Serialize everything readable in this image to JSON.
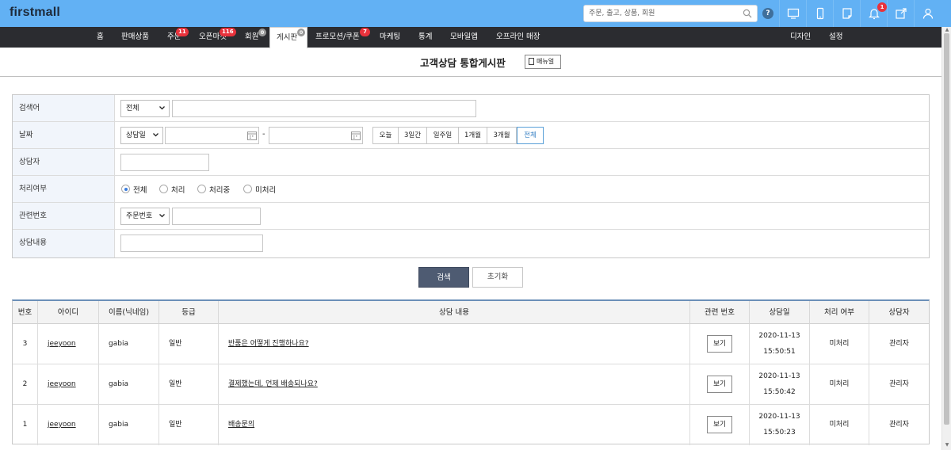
{
  "header": {
    "logo": "firstmall",
    "search_placeholder": "주문, 출고, 상품, 회원",
    "help": "?",
    "bell_badge": "1"
  },
  "menu": {
    "items": [
      {
        "label": "홈"
      },
      {
        "label": "판매상품"
      },
      {
        "label": "주문",
        "badge": "11"
      },
      {
        "label": "오픈마켓",
        "badge": "116"
      },
      {
        "label": "회원",
        "badge": "0"
      },
      {
        "label": "게시판",
        "badge": "0"
      },
      {
        "label": "프로모션/쿠폰",
        "badge": "7"
      },
      {
        "label": "마케팅"
      },
      {
        "label": "통계"
      },
      {
        "label": "모바일앱"
      },
      {
        "label": "오프라인 매장"
      }
    ],
    "right": [
      {
        "label": "디자인"
      },
      {
        "label": "설정"
      }
    ]
  },
  "page": {
    "title": "고객상담 통합게시판",
    "manual_label": "매뉴얼"
  },
  "filter": {
    "keyword_label": "검색어",
    "keyword_select": "전체",
    "date_label": "날짜",
    "date_select": "상담일",
    "date_sep": "-",
    "quick": [
      "오늘",
      "3일간",
      "일주일",
      "1개월",
      "3개월",
      "전체"
    ],
    "counselor_label": "상담자",
    "status_label": "처리여부",
    "status_options": [
      "전체",
      "처리",
      "처리중",
      "미처리"
    ],
    "related_label": "관련번호",
    "related_select": "주문번호",
    "content_label": "상담내용",
    "search_button": "검색",
    "reset_button": "초기화"
  },
  "table": {
    "headers": [
      "번호",
      "아이디",
      "이름(닉네임)",
      "등급",
      "상담 내용",
      "관련 번호",
      "상담일",
      "처리 여부",
      "상담자"
    ],
    "view_label": "보기",
    "rows": [
      {
        "no": "3",
        "id": "jeeyoon",
        "name": "gabia",
        "grade": "일반",
        "content": "반품은 어떻게 진행하나요?",
        "date": "2020-11-13",
        "time": "15:50:51",
        "status": "미처리",
        "counselor": "관리자"
      },
      {
        "no": "2",
        "id": "jeeyoon",
        "name": "gabia",
        "grade": "일반",
        "content": "결제했는데, 언제 배송되나요?",
        "date": "2020-11-13",
        "time": "15:50:42",
        "status": "미처리",
        "counselor": "관리자"
      },
      {
        "no": "1",
        "id": "jeeyoon",
        "name": "gabia",
        "grade": "일반",
        "content": "배송문의",
        "date": "2020-11-13",
        "time": "15:50:23",
        "status": "미처리",
        "counselor": "관리자"
      }
    ]
  }
}
